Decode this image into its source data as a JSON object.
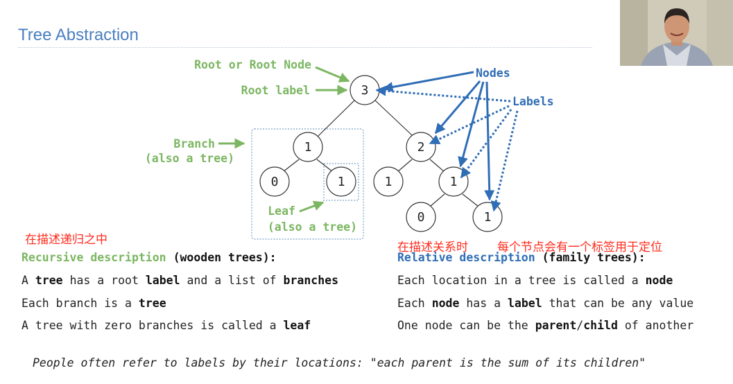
{
  "slide": {
    "title": "Tree Abstraction",
    "footer_italic": "People often refer to labels by their locations:",
    "footer_quote": "\"each parent is the sum of its children\""
  },
  "diagram": {
    "labels": {
      "root_or_root_node": "Root or Root Node",
      "root_label": "Root label",
      "branch": "Branch",
      "branch_note": "(also a tree)",
      "leaf": "Leaf",
      "leaf_note": "(also a tree)",
      "nodes": "Nodes",
      "labels": "Labels"
    },
    "nodes": {
      "root": "3",
      "left": "1",
      "left_left": "0",
      "left_right": "1",
      "right": "2",
      "right_left": "1",
      "right_right": "1",
      "rr_left": "0",
      "rr_right": "1"
    }
  },
  "annotations_cn": {
    "left": "在描述递归之中",
    "right_a": "在描述关系时",
    "right_b": "每个节点会有一个标签用于定位"
  },
  "left_column": {
    "heading_colored": "Recursive description",
    "heading_rest": "(wooden trees):",
    "line1": {
      "a": "A",
      "b": "tree",
      "c": "has a root",
      "d": "label",
      "e": "and a list of",
      "f": "branches"
    },
    "line2": {
      "a": "Each branch is a",
      "b": "tree"
    },
    "line3": {
      "a": "A tree with zero branches is called a",
      "b": "leaf"
    }
  },
  "right_column": {
    "heading_colored": "Relative description",
    "heading_rest": "(family trees):",
    "line1": {
      "a": "Each location in a tree is called a",
      "b": "node"
    },
    "line2": {
      "a": "Each",
      "b": "node",
      "c": "has a",
      "d": "label",
      "e": "that can be any value"
    },
    "line3": {
      "a": "One node can be the",
      "b": "parent",
      "c": "/",
      "d": "child",
      "e": "of another"
    }
  },
  "colors": {
    "title": "#4a7fc1",
    "green": "#7bb661",
    "blue": "#2f6db5",
    "cn_red": "#ff2b1c"
  },
  "webcam": {
    "icon": "presenter-video-feed"
  }
}
